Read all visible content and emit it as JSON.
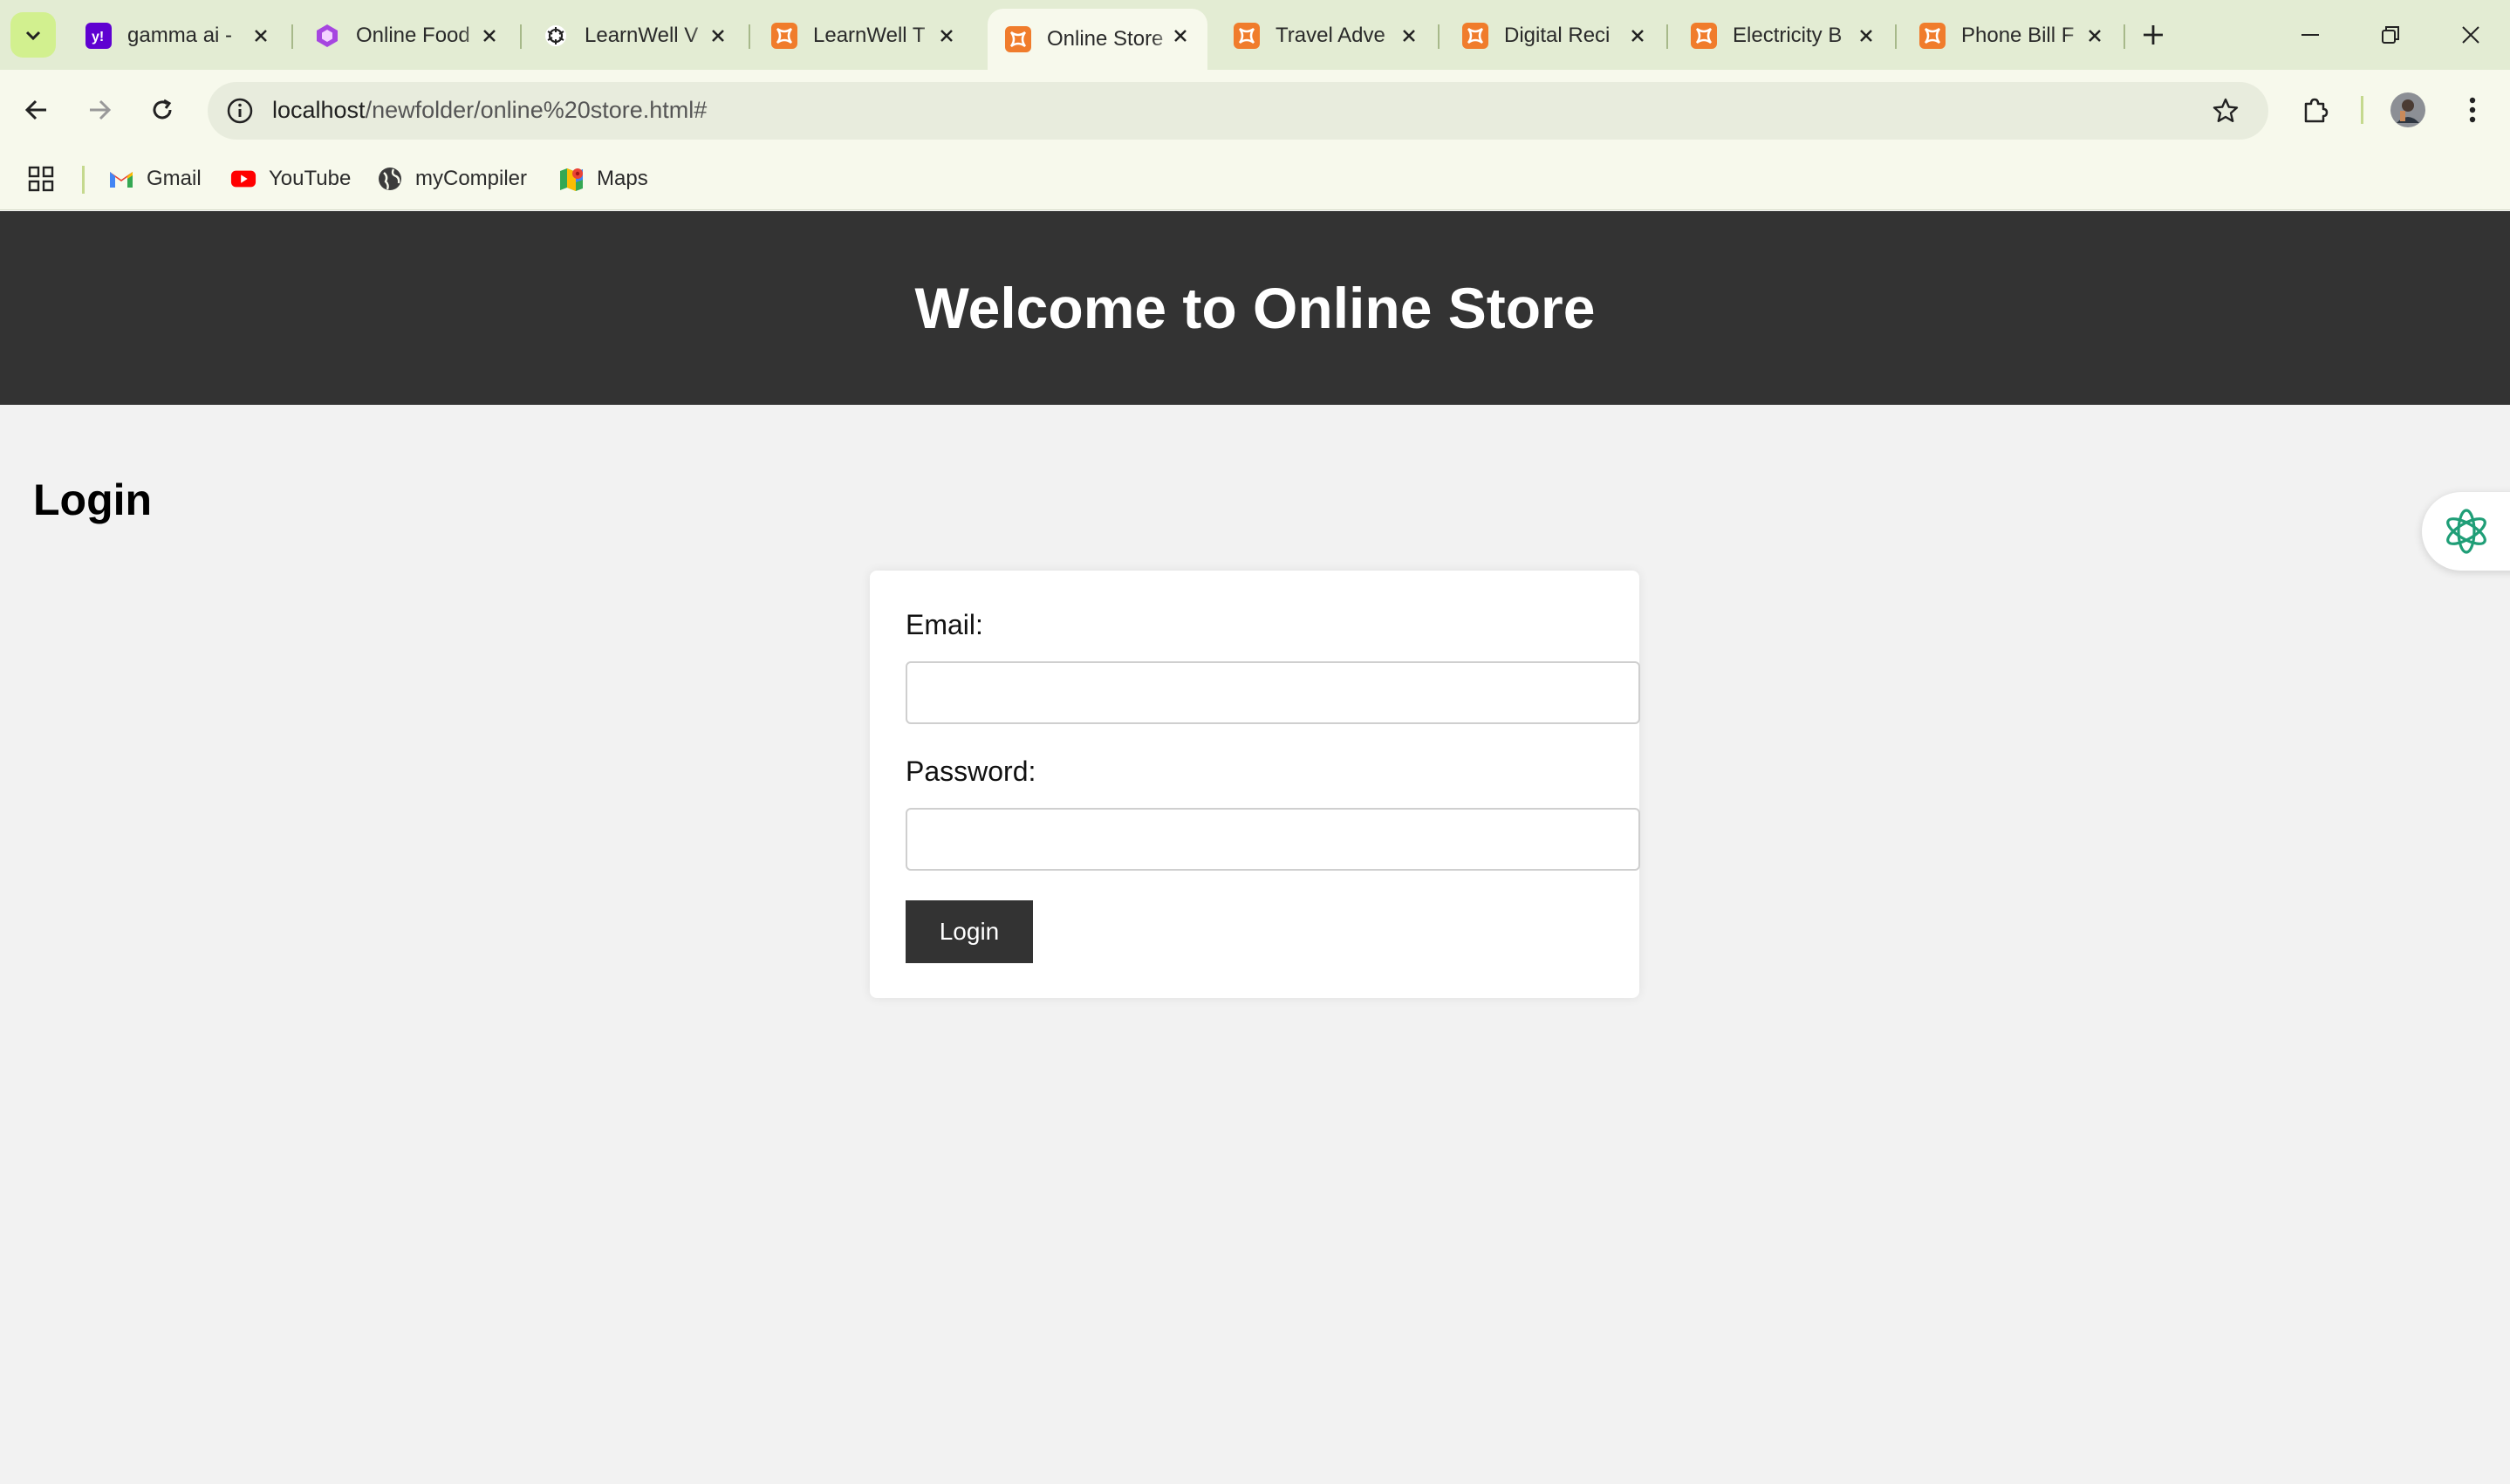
{
  "browser": {
    "tabs": [
      {
        "title": "gamma ai -",
        "favicon": "yahoo-icon",
        "active": false
      },
      {
        "title": "Online Food",
        "favicon": "gamma-icon",
        "active": false
      },
      {
        "title": "LearnWell V",
        "favicon": "openai-icon",
        "active": false
      },
      {
        "title": "LearnWell T",
        "favicon": "xampp-icon",
        "active": false
      },
      {
        "title": "Online Store",
        "favicon": "xampp-icon",
        "active": true
      },
      {
        "title": "Travel Adve",
        "favicon": "xampp-icon",
        "active": false
      },
      {
        "title": "Digital Reci",
        "favicon": "xampp-icon",
        "active": false
      },
      {
        "title": "Electricity B",
        "favicon": "xampp-icon",
        "active": false
      },
      {
        "title": "Phone Bill F",
        "favicon": "xampp-icon",
        "active": false
      }
    ],
    "url_host": "localhost",
    "url_path": "/newfolder/online%20store.html#",
    "bookmarks": [
      {
        "label": "Gmail",
        "icon": "gmail-icon"
      },
      {
        "label": "YouTube",
        "icon": "youtube-icon"
      },
      {
        "label": "myCompiler",
        "icon": "globe-icon"
      },
      {
        "label": "Maps",
        "icon": "maps-icon"
      }
    ]
  },
  "page": {
    "header_title": "Welcome to Online Store",
    "section_title": "Login",
    "form": {
      "email_label": "Email:",
      "email_value": "",
      "password_label": "Password:",
      "password_value": "",
      "submit_label": "Login"
    }
  },
  "colors": {
    "header_bg": "#333333",
    "page_bg": "#f2f2f2",
    "button_bg": "#333333",
    "chrome_bg": "#e3ecd3"
  }
}
